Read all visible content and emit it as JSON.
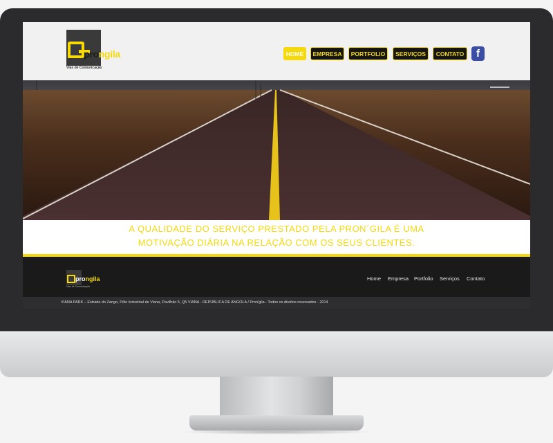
{
  "header": {
    "logo_text_main": "pro",
    "logo_text_accent": "ngila",
    "logo_tagline": "Vias de Comunicação",
    "nav": [
      {
        "label": "HOME",
        "active": true
      },
      {
        "label": "EMPRESA",
        "active": false
      },
      {
        "label": "PORTFOLIO",
        "active": false
      },
      {
        "label": "SERVIÇOS",
        "active": false
      },
      {
        "label": "CONTATO",
        "active": false
      }
    ],
    "facebook_icon": "f"
  },
  "tagline": {
    "line1": "A QUALIDADE DO SERVIÇO PRESTADO PELA PRON´GILA É UMA",
    "line2": "MOTIVAÇÃO DIÁRIA NA RELAÇÃO COM OS SEUS CLIENTES."
  },
  "footer": {
    "logo_text_main": "pro",
    "logo_text_accent": "ngila",
    "logo_tagline": "Vias de Comunicação",
    "nav": [
      "Home",
      "Empresa",
      "Portfolio",
      "Serviços",
      "Contato"
    ],
    "copyright": "VIANA PARK – Estrada do Zango, Pólo Industrial de Viana, Pavilhão 5, Q5 VIANA - REPÚBLICA DE ANGOLA / Pron'gila - Todos os direitos reservados - 2014"
  },
  "colors": {
    "accent": "#f5d90a",
    "dark": "#1a1a1b",
    "header_bg": "#f1f1f1",
    "facebook": "#3b4ea3"
  }
}
